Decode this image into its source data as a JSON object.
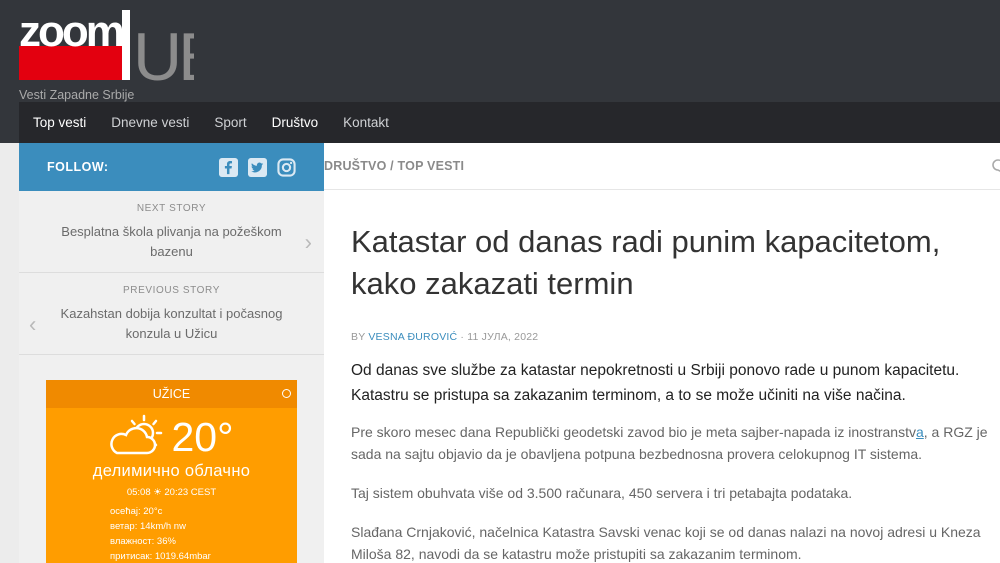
{
  "site": {
    "logo_main": "zoom",
    "logo_accent": "UE",
    "tagline": "Vesti Zapadne Srbije"
  },
  "nav": {
    "items": [
      {
        "label": "Top vesti"
      },
      {
        "label": "Dnevne vesti"
      },
      {
        "label": "Sport"
      },
      {
        "label": "Društvo"
      },
      {
        "label": "Kontakt"
      }
    ]
  },
  "sidebar": {
    "follow_label": "FOLLOW:",
    "socials": [
      "facebook-icon",
      "twitter-icon",
      "instagram-icon"
    ],
    "next_story": {
      "kicker": "NEXT STORY",
      "title": "Besplatna škola plivanja na požeškom bazenu"
    },
    "previous_story": {
      "kicker": "PREVIOUS STORY",
      "title": "Kazahstan dobija konzultat i počasnog konzula u Užicu"
    }
  },
  "weather": {
    "city": "UŽICE",
    "temperature": "20°",
    "condition": "делимично облачно",
    "sun_times": "05:08 ☀ 20:23 CEST",
    "details": [
      "осећај: 20°c",
      "ветар: 14km/h nw",
      "влажност: 36%",
      "притисак: 1019.64mbar"
    ]
  },
  "article": {
    "breadcrumb": "DRUŠTVO / TOP VESTI",
    "title": "Katastar od danas radi punim kapacitetom, kako zakazati termin",
    "meta_by": "BY ",
    "author": "VESNA ĐUROVIĆ",
    "date": " · 11 ЈУЛА, 2022",
    "lead": "Od danas sve službe za katastar nepokretnosti u Srbiji ponovo rade u punom kapacitetu. Katastru se pristupa sa zakazanim terminom, a to se može učiniti na više načina.",
    "p1_before": "Pre skoro mesec dana Republički geodetski zavod bio je meta sajber-napada iz inostranstv",
    "p1_link": "a",
    "p1_after": ", a RGZ je sada na sajtu objavio da je obavljena potpuna bezbednosna provera celokupnog IT sistema.",
    "p2": "Taj sistem obuhvata više od 3.500 računara, 450 servera i tri petabajta podataka.",
    "p3": "Slađana Crnjaković, načelnica Katastra Savski venac koji se od danas nalazi na novoj adresi u Kneza Miloša 82, navodi da se katastru može pristupiti sa zakazanim terminom."
  },
  "colors": {
    "header": "#33363b",
    "nav": "#26272b",
    "accent_blue": "#3b8dbd",
    "logo_red": "#e3000f",
    "weather_orange": "#ff9d00"
  }
}
